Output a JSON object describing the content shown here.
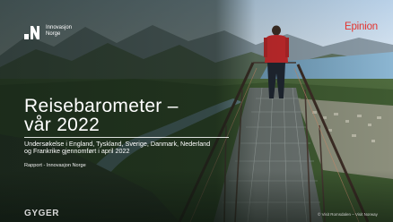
{
  "brand": {
    "name_line1": "Innovasjon",
    "name_line2": "Norge"
  },
  "partner": {
    "logo_text": "Epinion",
    "logo_color": "#e3342f"
  },
  "title": {
    "line1": "Reisebarometer –",
    "line2": "vår 2022"
  },
  "subtitle": {
    "line1": "Undersøkelse i England, Tyskland, Sverige, Danmark, Nederland",
    "line2": "og Frankrike gjennomført i april 2022"
  },
  "report_label": "Rapport - Innovasjon Norge",
  "footer": {
    "agency": "GYGER",
    "photo_credit": "© Visit Romsdalen – Visit Norway"
  },
  "colors": {
    "overlay": "#0f1d14",
    "text": "#ffffff"
  }
}
